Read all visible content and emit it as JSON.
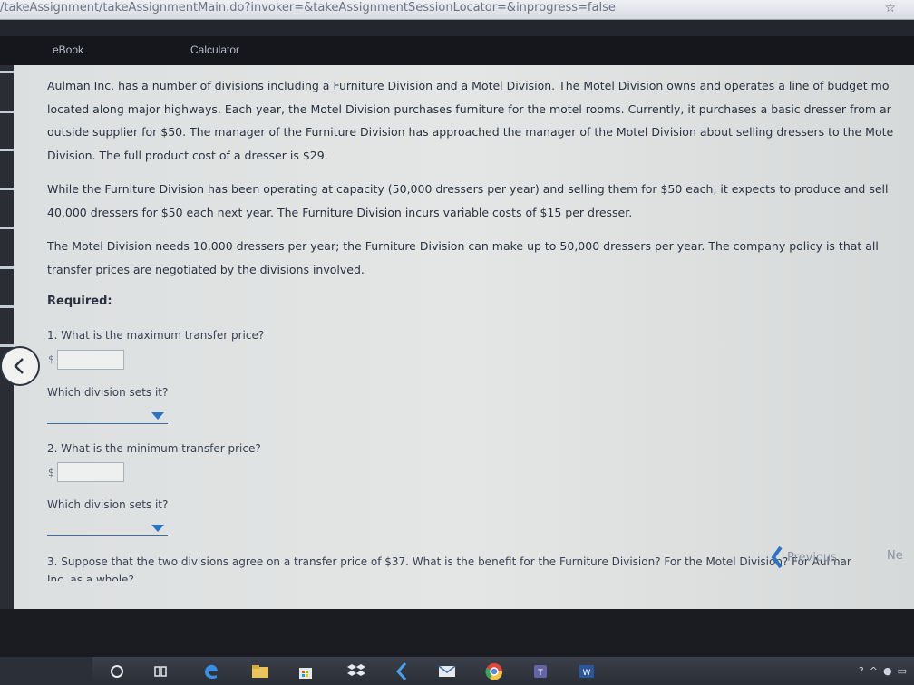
{
  "browser": {
    "url": "/takeAssignment/takeAssignmentMain.do?invoker=&takeAssignmentSessionLocator=&inprogress=false",
    "star": "☆"
  },
  "nav": {
    "tabs": [
      "eBook",
      "Calculator"
    ]
  },
  "problem": {
    "paragraph1": [
      "Aulman Inc. has a number of divisions including a Furniture Division and a Motel Division. The Motel Division owns and operates a line of budget mo",
      "located along major highways. Each year, the Motel Division purchases furniture for the motel rooms. Currently, it purchases a basic dresser from ar",
      "outside supplier for $50. The manager of the Furniture Division has approached the manager of the Motel Division about selling dressers to the Mote",
      "Division. The full product cost of a dresser is $29."
    ],
    "paragraph2": [
      "While the Furniture Division has been operating at capacity (50,000 dressers per year) and selling them for $50 each, it expects to produce and sell",
      "40,000 dressers for $50 each next year. The Furniture Division incurs variable costs of $15 per dresser."
    ],
    "paragraph3": [
      "The Motel Division needs 10,000 dressers per year; the Furniture Division can make up to 50,000 dressers per year. The company policy is that all",
      "transfer prices are negotiated by the divisions involved."
    ],
    "required_label": "Required:"
  },
  "questions": {
    "q1": "1.  What is the maximum transfer price?",
    "q1_division": "Which division sets it?",
    "q2": "2.  What is the minimum transfer price?",
    "q2_division": "Which division sets it?",
    "q3_line1": "3.  Suppose that the two divisions agree on a transfer price of $37. What is the benefit for the Furniture Division? For the Motel Division? For Aulmar",
    "q3_line2": "Inc. as a whole?",
    "currency_symbol": "$",
    "q1_answer": "",
    "q2_answer": ""
  },
  "pager": {
    "previous": "Previous",
    "next": "Ne"
  },
  "colors": {
    "accent": "#2b74c4",
    "text": "#2a3140"
  },
  "taskbar": {
    "icons": [
      "cortana-icon",
      "task-view-icon",
      "edge-icon",
      "file-explorer-icon",
      "store-icon",
      "dropbox-icon",
      "arrow-app-icon",
      "mail-icon",
      "chrome-icon",
      "teams-icon",
      "word-icon"
    ]
  }
}
